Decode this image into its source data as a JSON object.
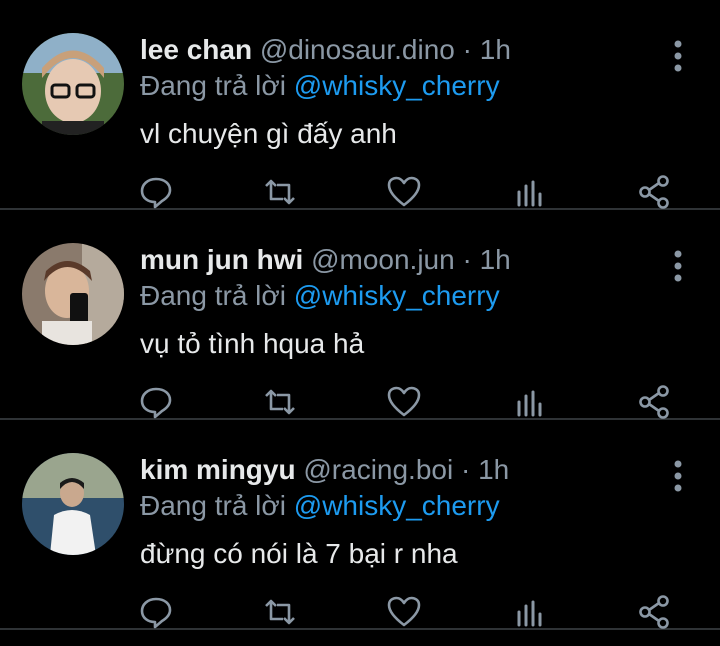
{
  "tweets": [
    {
      "name": "lee chan",
      "handle": "@dinosaur.dino",
      "dot": "·",
      "time": "1h",
      "reply_prefix": "Đang trả lời",
      "reply_to": "@whisky_cherry",
      "text": "vl chuyện gì đấy anh",
      "avatar_bg": "#4c6b3a"
    },
    {
      "name": "mun jun hwi",
      "handle": "@moon.jun",
      "dot": "·",
      "time": "1h",
      "reply_prefix": "Đang trả lời",
      "reply_to": "@whisky_cherry",
      "text": "vụ tỏ tình hqua hả",
      "avatar_bg": "#8a7a6c"
    },
    {
      "name": "kim mingyu",
      "handle": "@racing.boi",
      "dot": "·",
      "time": "1h",
      "reply_prefix": "Đang trả lời",
      "reply_to": "@whisky_cherry",
      "text": "đừng có nói là 7 bại r nha",
      "avatar_bg": "#2f4f6b"
    }
  ],
  "icons": [
    "reply-icon",
    "retweet-icon",
    "like-icon",
    "analytics-icon",
    "share-icon",
    "more-options-icon"
  ],
  "colors": {
    "background": "#000000",
    "text": "#e7e9ea",
    "muted": "#8b98a5",
    "link": "#1d9bf0",
    "divider": "#2f3336"
  }
}
